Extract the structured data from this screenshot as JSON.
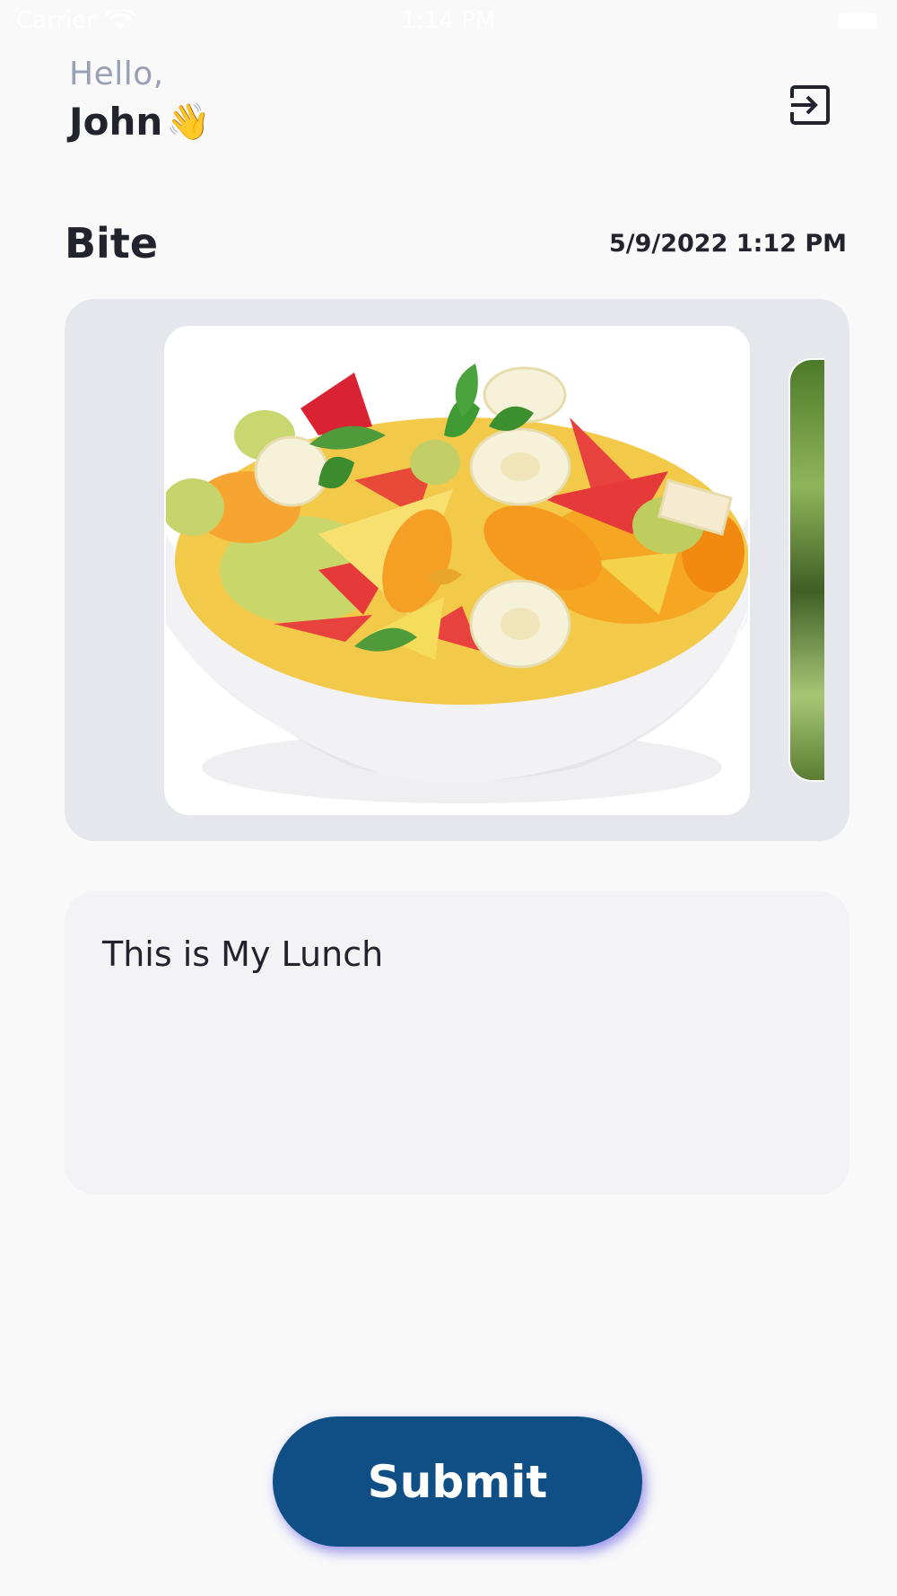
{
  "status_bar": {
    "carrier": "Carrier",
    "time": "1:14 PM"
  },
  "header": {
    "greeting": "Hello,",
    "name": "John",
    "wave_emoji": "👋",
    "logout_icon": "logout-icon"
  },
  "post": {
    "title": "Bite",
    "timestamp": "5/9/2022 1:12 PM"
  },
  "carousel": {
    "items": [
      {
        "image": "fruit-salad-bowl"
      },
      {
        "image": "green-leaves"
      }
    ]
  },
  "caption": {
    "text": "This is My Lunch"
  },
  "actions": {
    "submit_label": "Submit"
  },
  "colors": {
    "background": "#f9f9fa",
    "primary": "#0f4f86",
    "muted_text": "#9aa0b3",
    "card_bg": "#e6e7ec",
    "caption_bg": "#f3f3f6"
  }
}
